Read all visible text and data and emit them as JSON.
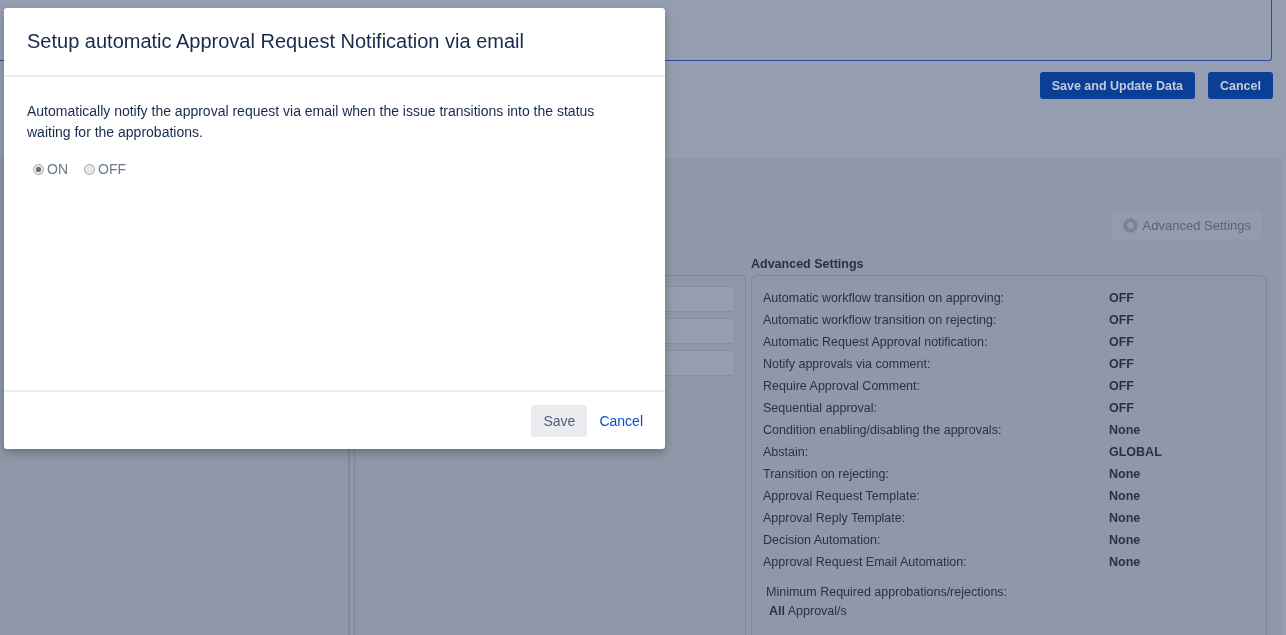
{
  "page": {
    "buttons": [
      "Save and Update Data",
      "Cancel"
    ],
    "advanced_settings_button": "Advanced Settings",
    "advanced_settings": {
      "title": "Advanced Settings",
      "rows": [
        {
          "label": "Automatic workflow transition on approving:",
          "value": "OFF"
        },
        {
          "label": "Automatic workflow transition on rejecting:",
          "value": "OFF"
        },
        {
          "label": "Automatic Request Approval notification:",
          "value": "OFF"
        },
        {
          "label": "Notify approvals via comment:",
          "value": "OFF"
        },
        {
          "label": "Require Approval Comment:",
          "value": "OFF"
        },
        {
          "label": "Sequential approval:",
          "value": "OFF"
        },
        {
          "label": "Condition enabling/disabling the approvals:",
          "value": "None"
        },
        {
          "label": "Abstain:",
          "value": "GLOBAL"
        },
        {
          "label": "Transition on rejecting:",
          "value": "None"
        },
        {
          "label": "Approval Request Template:",
          "value": "None"
        },
        {
          "label": "Approval Reply Template:",
          "value": "None"
        },
        {
          "label": "Decision Automation:",
          "value": "None"
        },
        {
          "label": "Approval Request Email Automation:",
          "value": "None"
        }
      ],
      "minimum_required": {
        "label": "Minimum Required approbations/rejections:",
        "value": "**All** Approval/s"
      }
    }
  },
  "dialog": {
    "title": "Setup automatic Approval Request Notification via email",
    "description": "Automatically notify the approval request via email when the issue transitions into the status waiting for the approbations.",
    "options": [
      {
        "label": "ON",
        "selected": true
      },
      {
        "label": "OFF",
        "selected": false
      }
    ],
    "buttons": [
      {
        "label": "Save",
        "kind": "button"
      },
      {
        "label": "Cancel",
        "kind": "link"
      }
    ]
  }
}
